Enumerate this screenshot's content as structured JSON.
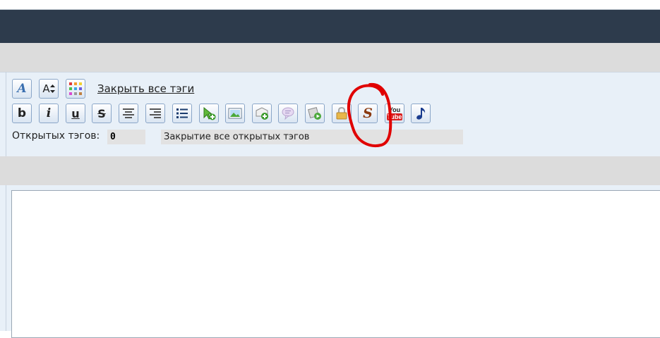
{
  "toolbar": {
    "row1": [
      {
        "name": "font-face-button",
        "glyph": "A",
        "icon": "font-icon"
      },
      {
        "name": "font-size-button",
        "glyph": "A",
        "icon": "font-size-icon"
      },
      {
        "name": "color-button",
        "icon": "color-palette-icon"
      }
    ],
    "close_all_label": "Закрыть все тэги",
    "row2": [
      {
        "name": "bold-button",
        "glyph": "b",
        "icon": "bold-icon"
      },
      {
        "name": "italic-button",
        "glyph": "i",
        "icon": "italic-icon"
      },
      {
        "name": "underline-button",
        "glyph": "u",
        "icon": "underline-icon"
      },
      {
        "name": "strike-button",
        "glyph": "S",
        "icon": "strikethrough-icon"
      },
      {
        "name": "align-center-button",
        "icon": "align-center-icon"
      },
      {
        "name": "align-right-button",
        "icon": "align-right-icon"
      },
      {
        "name": "list-button",
        "icon": "list-icon"
      },
      {
        "name": "link-button",
        "icon": "link-icon"
      },
      {
        "name": "image-button",
        "icon": "image-icon"
      },
      {
        "name": "attach-image-button",
        "icon": "add-image-icon"
      },
      {
        "name": "quote-button",
        "icon": "quote-icon"
      },
      {
        "name": "video-button",
        "icon": "video-icon"
      },
      {
        "name": "hide-button",
        "icon": "lock-icon"
      },
      {
        "name": "spoiler-button",
        "glyph": "S",
        "icon": "spoiler-icon"
      },
      {
        "name": "youtube-button",
        "icon": "youtube-icon"
      },
      {
        "name": "music-button",
        "icon": "music-note-icon"
      }
    ]
  },
  "status_row": {
    "open_tags_label": "Открытых тэгов:",
    "open_tags_count": "0",
    "status_text": "Закрытие все открытых тэгов"
  },
  "colors": {
    "header": "#2d3b4c",
    "panel": "#e8f0f8",
    "grey_bar": "#dcdcdc",
    "annotation": "#e00000"
  },
  "youtube": {
    "top": "You",
    "bottom": "Tube"
  }
}
